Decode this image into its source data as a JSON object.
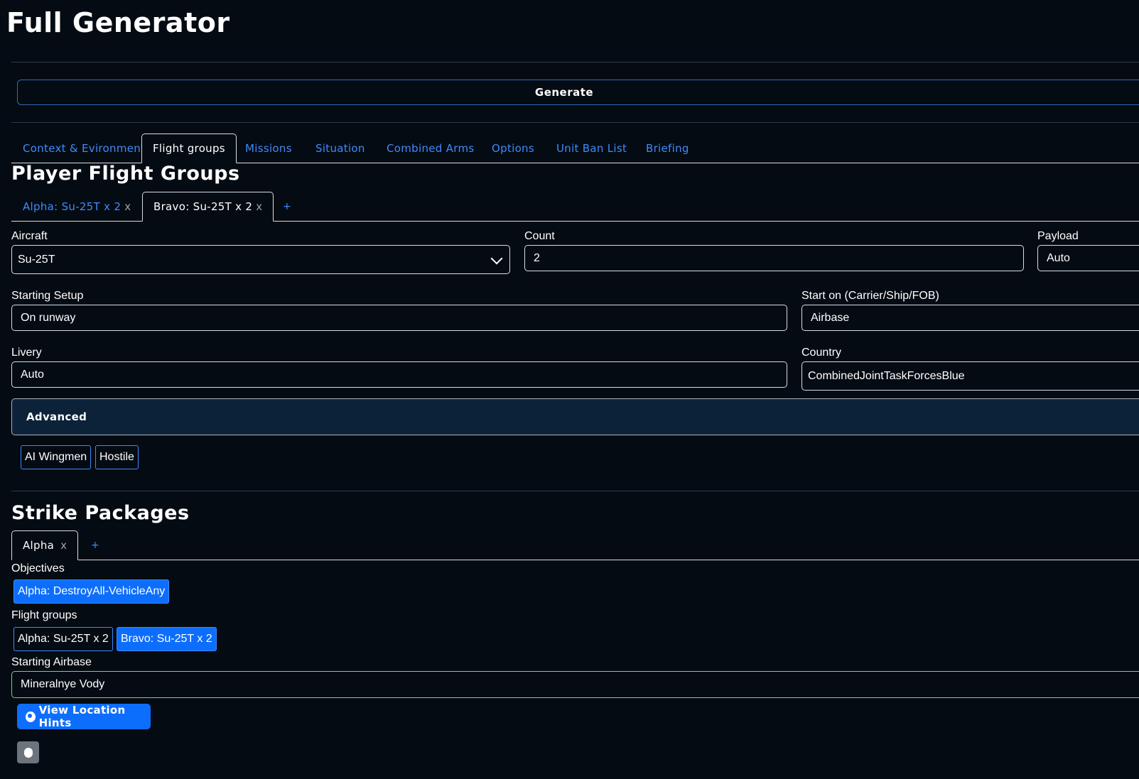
{
  "title": "Full Generator",
  "generate_label": "Generate",
  "main_tabs": [
    {
      "label": "Context & Evironment"
    },
    {
      "label": "Flight groups"
    },
    {
      "label": "Missions"
    },
    {
      "label": "Situation"
    },
    {
      "label": "Combined Arms"
    },
    {
      "label": "Options"
    },
    {
      "label": "Unit Ban List"
    },
    {
      "label": "Briefing"
    }
  ],
  "player_flight_groups": {
    "heading": "Player Flight Groups",
    "tabs": [
      {
        "label": "Alpha: Su-25T x 2",
        "close": "x"
      },
      {
        "label": "Bravo: Su-25T x 2",
        "close": "x"
      }
    ],
    "add_label": "+",
    "aircraft": {
      "label": "Aircraft",
      "value": "Su-25T"
    },
    "count": {
      "label": "Count",
      "value": "2"
    },
    "payload": {
      "label": "Payload",
      "value": "Auto"
    },
    "starting_setup": {
      "label": "Starting Setup",
      "value": "On runway"
    },
    "start_on": {
      "label": "Start on (Carrier/Ship/FOB)",
      "value": "Airbase"
    },
    "livery": {
      "label": "Livery",
      "value": "Auto"
    },
    "country": {
      "label": "Country",
      "value": "CombinedJointTaskForcesBlue"
    },
    "advanced_label": "Advanced",
    "toggles": [
      {
        "label": "AI Wingmen"
      },
      {
        "label": "Hostile"
      }
    ]
  },
  "strike_packages": {
    "heading": "Strike Packages",
    "tabs": [
      {
        "label": "Alpha",
        "close": "x"
      }
    ],
    "add_label": "+",
    "objectives_label": "Objectives",
    "objectives": [
      {
        "label": "Alpha: DestroyAll-VehicleAny",
        "selected": true
      }
    ],
    "flight_groups_label": "Flight groups",
    "flight_groups": [
      {
        "label": "Alpha: Su-25T x 2",
        "selected": false
      },
      {
        "label": "Bravo: Su-25T x 2",
        "selected": true
      }
    ],
    "starting_airbase": {
      "label": "Starting Airbase",
      "value": "Mineralnye Vody"
    },
    "hints_label": "View Location Hints"
  },
  "icons": [
    "chevron-down-icon",
    "globe-icon",
    "bug-icon"
  ],
  "colors": {
    "background": "#050b12",
    "accent": "#0d6efd",
    "link": "#3d8bfd",
    "advanced_bg": "#0c2238"
  }
}
